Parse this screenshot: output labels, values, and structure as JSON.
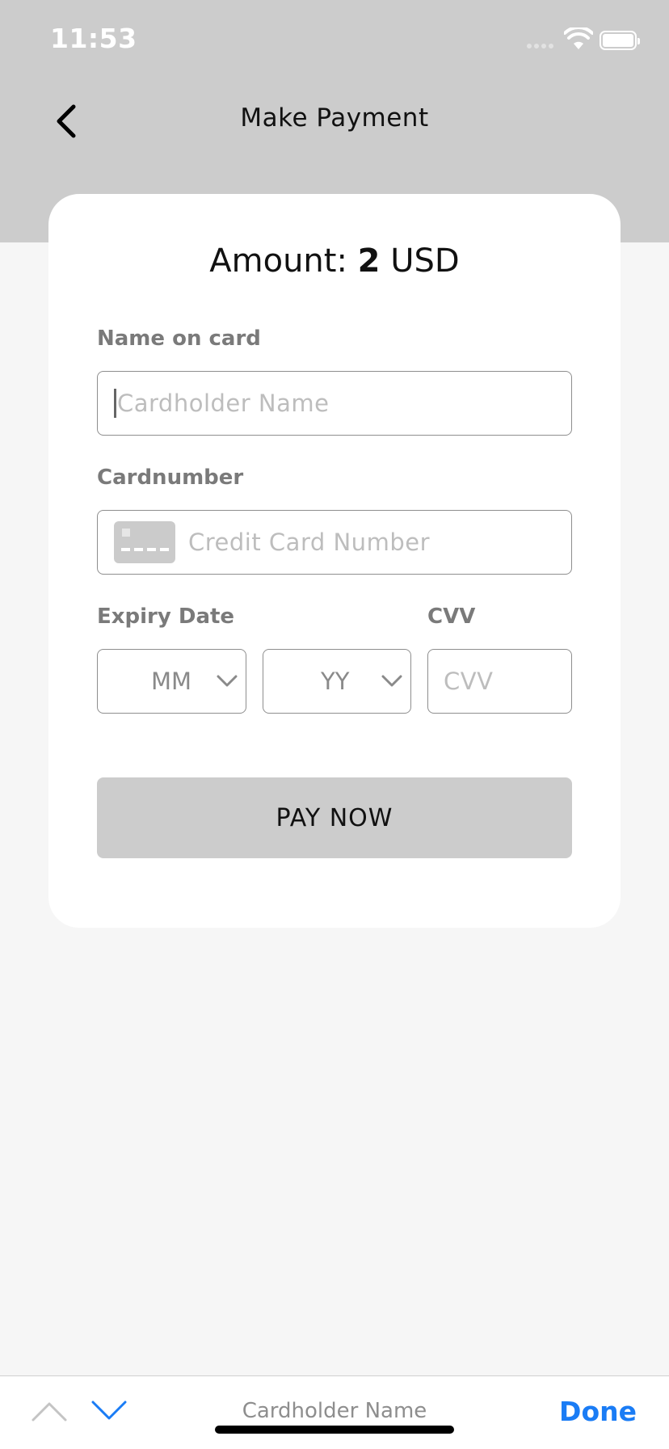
{
  "status_bar": {
    "time": "11:53"
  },
  "nav": {
    "title": "Make Payment",
    "back_icon": "chevron-left-icon"
  },
  "payment": {
    "amount_prefix": "Amount: ",
    "amount_value": "2",
    "amount_currency": " USD",
    "name_label": "Name on card",
    "name_placeholder": "Cardholder Name",
    "card_label": "Cardnumber",
    "card_placeholder": "Credit Card Number",
    "card_icon": "credit-card-icon",
    "expiry_label": "Expiry Date",
    "month_value": "MM",
    "year_value": "YY",
    "cvv_label": "CVV",
    "cvv_placeholder": "CVV",
    "pay_button": "PAY NOW"
  },
  "keyboard_toolbar": {
    "current_field": "Cardholder Name",
    "done_label": "Done"
  },
  "colors": {
    "header_bg": "#cccccc",
    "page_bg": "#f6f6f6",
    "accent": "#1a7cf5"
  }
}
